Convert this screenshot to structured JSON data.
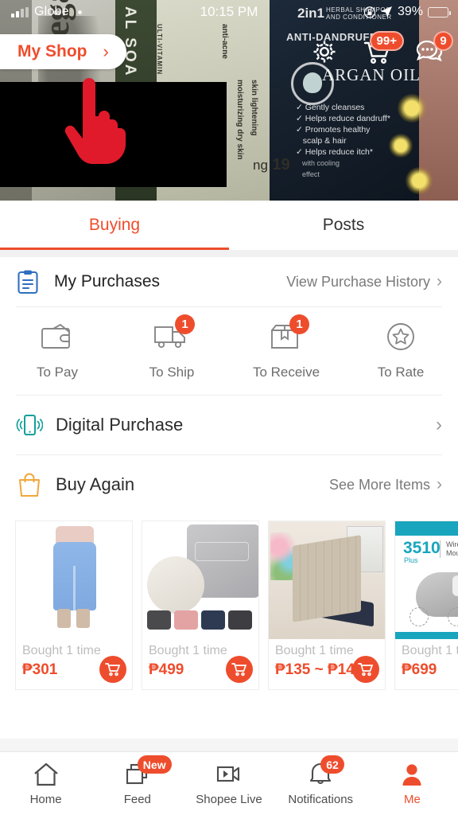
{
  "status_bar": {
    "carrier": "Globe",
    "time": "10:15 PM",
    "battery_percent": "39%",
    "lock_icon": "lock-icon",
    "location_icon": "location-arrow-icon",
    "signal_icon": "signal-bars-icon",
    "battery_icon": "battery-low-power-icon"
  },
  "header": {
    "my_shop_label": "My Shop",
    "my_shop_chevron": "›",
    "settings_icon": "gear-icon",
    "cart_icon": "cart-icon",
    "cart_badge": "99+",
    "chat_icon": "chat-bubble-icon",
    "chat_badge": "9"
  },
  "banner": {
    "pack_2in1": "2in1",
    "pack_herbal": "HERBAL SHAMPOO\nAND CONDITIONER",
    "pack_anti": "ANTI-DANDRUFF",
    "pack_brand": "ARGAN OIL",
    "pack_with": "with",
    "pack_bullets": "✓ Gently cleanses\n✓ Helps reduce dandruff*\n✓ Promotes healthy\n   scalp & hair\n✓ Helps reduce itch*",
    "pack_cooling": "with cooling\neffect",
    "soap_label": "AL SOA",
    "soap_vitamin": "ULTI-VITAMIN",
    "soap_acne": "anti-acne",
    "soap_dry": "moisturizing dry skin",
    "soap_light": "skin lightening",
    "soap_ega": "ega",
    "price_number": "19",
    "price_prefix": "ng",
    "cursor_icon": "pointing-hand-cursor"
  },
  "tabs": [
    {
      "label": "Buying",
      "active": true
    },
    {
      "label": "Posts",
      "active": false
    }
  ],
  "purchases": {
    "icon": "clipboard-icon",
    "title": "My Purchases",
    "history_link": "View Purchase History",
    "chevron": "›",
    "statuses": [
      {
        "label": "To Pay",
        "badge": "",
        "icon": "wallet-icon"
      },
      {
        "label": "To Ship",
        "badge": "1",
        "icon": "truck-icon"
      },
      {
        "label": "To Receive",
        "badge": "1",
        "icon": "package-icon"
      },
      {
        "label": "To Rate",
        "badge": "",
        "icon": "star-circle-icon"
      }
    ]
  },
  "digital_purchase": {
    "icon": "mobile-signal-icon",
    "title": "Digital Purchase",
    "chevron": "›"
  },
  "buy_again": {
    "icon": "shopping-bag-icon",
    "title": "Buy Again",
    "see_more": "See More Items",
    "chevron": "›",
    "items": [
      {
        "bought": "Bought 1 time",
        "price": "₱301",
        "cart_icon": "add-to-cart-icon",
        "art": "jeans"
      },
      {
        "bought": "Bought 1 time",
        "price": "₱499",
        "cart_icon": "add-to-cart-icon",
        "art": "sleeve"
      },
      {
        "bought": "Bought 1 time",
        "price": "₱135 ~ ₱148",
        "cart_icon": "add-to-cart-icon",
        "art": "stand"
      },
      {
        "bought": "Bought 1 t",
        "price": "₱699",
        "cart_icon": "add-to-cart-icon",
        "art": "mouse",
        "label_num": "3510",
        "label_sub": "Plus",
        "label_txt": "Wireless\nMouse"
      }
    ]
  },
  "bottom_nav": [
    {
      "label": "Home",
      "icon": "home-icon",
      "badge": "",
      "active": false
    },
    {
      "label": "Feed",
      "icon": "feed-icon",
      "badge": "New",
      "active": false
    },
    {
      "label": "Shopee Live",
      "icon": "live-video-icon",
      "badge": "",
      "active": false
    },
    {
      "label": "Notifications",
      "icon": "bell-icon",
      "badge": "62",
      "active": false
    },
    {
      "label": "Me",
      "icon": "person-icon",
      "badge": "",
      "active": true
    }
  ],
  "colors": {
    "brand_orange": "#ee4d2d",
    "clipboard_blue": "#2f6fbf",
    "digital_teal": "#12a09a",
    "bag_amber": "#f0a73c",
    "cursor_red": "#e01a2b"
  }
}
